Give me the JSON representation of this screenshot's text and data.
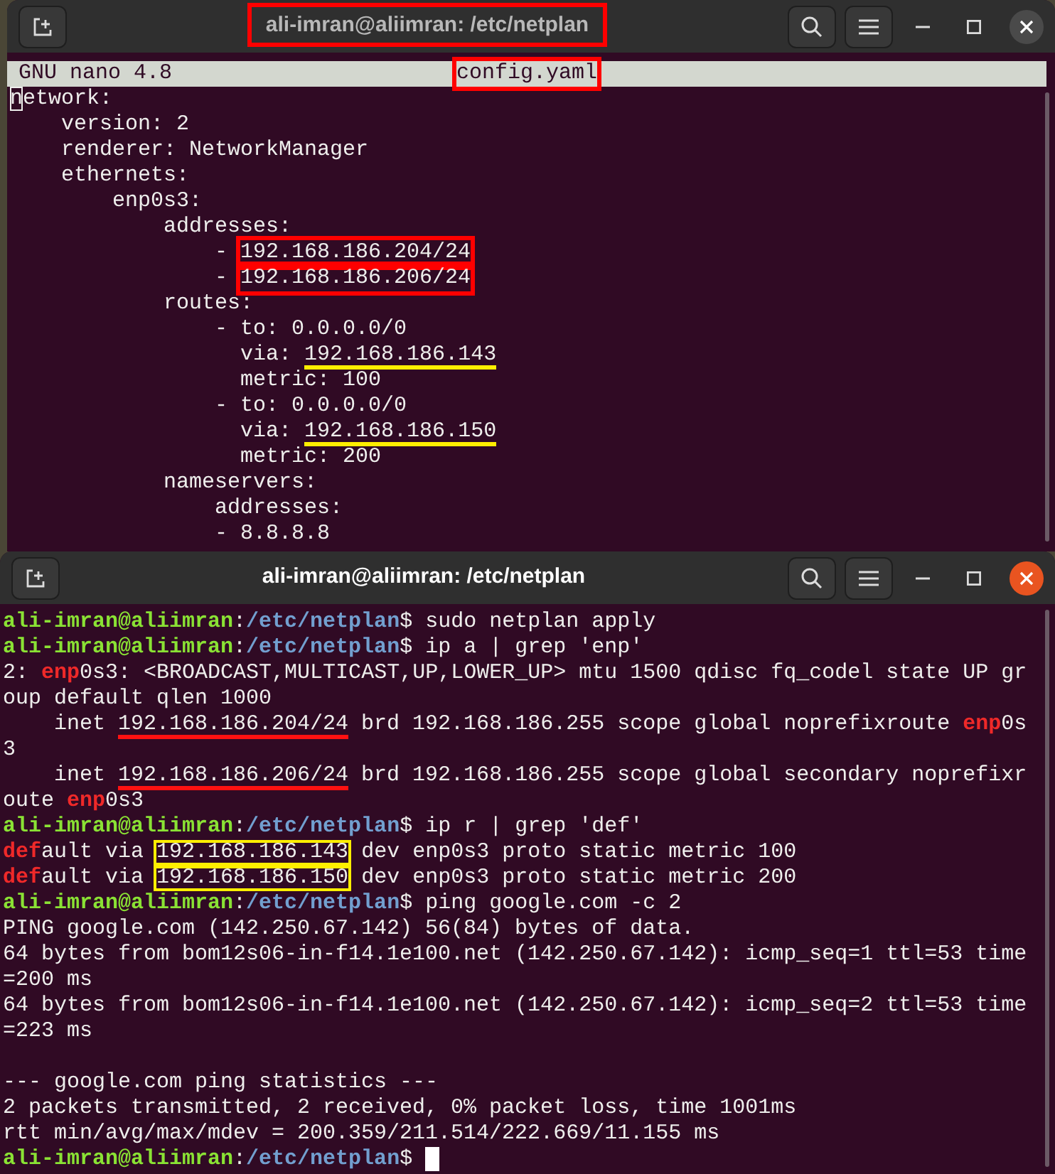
{
  "windows": [
    {
      "title": "ali-imran@aliimran: /etc/netplan",
      "active": false,
      "title_boxed": true,
      "editor": {
        "app": "GNU nano 4.8",
        "filename": "config.yaml",
        "filename_boxed": true
      },
      "lines": [
        {
          "segments": [
            {
              "text": "n",
              "kind": "cursor"
            },
            {
              "text": "etwork:"
            }
          ]
        },
        {
          "segments": [
            {
              "text": "    version: 2"
            }
          ]
        },
        {
          "segments": [
            {
              "text": "    renderer: NetworkManager"
            }
          ]
        },
        {
          "segments": [
            {
              "text": "    ethernets:"
            }
          ]
        },
        {
          "segments": [
            {
              "text": "        enp0s3:"
            }
          ]
        },
        {
          "segments": [
            {
              "text": "            addresses:"
            }
          ]
        },
        {
          "segments": [
            {
              "text": "                - "
            },
            {
              "text": "192.168.186.204/24",
              "kind": "redbox"
            }
          ]
        },
        {
          "segments": [
            {
              "text": "                - "
            },
            {
              "text": "192.168.186.206/24",
              "kind": "redbox"
            }
          ]
        },
        {
          "segments": [
            {
              "text": "            routes:"
            }
          ]
        },
        {
          "segments": [
            {
              "text": "                - to: 0.0.0.0/0"
            }
          ]
        },
        {
          "segments": [
            {
              "text": "                  via: "
            },
            {
              "text": "192.168.186.143",
              "kind": "underline"
            }
          ]
        },
        {
          "segments": [
            {
              "text": "                  metric: 100"
            }
          ]
        },
        {
          "segments": [
            {
              "text": "                - to: 0.0.0.0/0"
            }
          ]
        },
        {
          "segments": [
            {
              "text": "                  via: "
            },
            {
              "text": "192.168.186.150",
              "kind": "underline"
            }
          ]
        },
        {
          "segments": [
            {
              "text": "                  metric: 200"
            }
          ]
        },
        {
          "segments": [
            {
              "text": "            nameservers:"
            }
          ]
        },
        {
          "segments": [
            {
              "text": "                addresses:"
            }
          ]
        },
        {
          "segments": [
            {
              "text": "                - 8.8.8.8"
            }
          ]
        }
      ]
    },
    {
      "title": "ali-imran@aliimran: /etc/netplan",
      "active": true,
      "lines": [
        {
          "segments": [
            {
              "text": "ali-imran@aliimran",
              "kind": "user"
            },
            {
              "text": ":"
            },
            {
              "text": "/etc/netplan",
              "kind": "path"
            },
            {
              "text": "$ sudo netplan apply"
            }
          ]
        },
        {
          "segments": [
            {
              "text": "ali-imran@aliimran",
              "kind": "user"
            },
            {
              "text": ":"
            },
            {
              "text": "/etc/netplan",
              "kind": "path"
            },
            {
              "text": "$ ip a | grep 'enp'"
            }
          ]
        },
        {
          "segments": [
            {
              "text": "2: "
            },
            {
              "text": "enp",
              "kind": "match"
            },
            {
              "text": "0s3: <BROADCAST,MULTICAST,UP,LOWER_UP> mtu 1500 qdisc fq_codel state UP gr"
            }
          ]
        },
        {
          "segments": [
            {
              "text": "oup default qlen 1000"
            }
          ]
        },
        {
          "segments": [
            {
              "text": "    inet "
            },
            {
              "text": "192.168.186.204/24",
              "kind": "redline"
            },
            {
              "text": " brd 192.168.186.255 scope global noprefixroute "
            },
            {
              "text": "enp",
              "kind": "match"
            },
            {
              "text": "0s"
            }
          ]
        },
        {
          "segments": [
            {
              "text": "3"
            }
          ]
        },
        {
          "segments": [
            {
              "text": "    inet "
            },
            {
              "text": "192.168.186.206/24",
              "kind": "redline"
            },
            {
              "text": " brd 192.168.186.255 scope global secondary noprefixr"
            }
          ]
        },
        {
          "segments": [
            {
              "text": "oute "
            },
            {
              "text": "enp",
              "kind": "match"
            },
            {
              "text": "0s3"
            }
          ]
        },
        {
          "segments": [
            {
              "text": "ali-imran@aliimran",
              "kind": "user"
            },
            {
              "text": ":"
            },
            {
              "text": "/etc/netplan",
              "kind": "path"
            },
            {
              "text": "$ ip r | grep 'def'"
            }
          ]
        },
        {
          "segments": [
            {
              "text": "def",
              "kind": "match"
            },
            {
              "text": "ault via "
            },
            {
              "text": "192.168.186.143",
              "kind": "framed"
            },
            {
              "text": " dev enp0s3 proto static metric 100"
            }
          ]
        },
        {
          "segments": [
            {
              "text": "def",
              "kind": "match"
            },
            {
              "text": "ault via "
            },
            {
              "text": "192.168.186.150",
              "kind": "framed"
            },
            {
              "text": " dev enp0s3 proto static metric 200"
            }
          ]
        },
        {
          "segments": [
            {
              "text": "ali-imran@aliimran",
              "kind": "user"
            },
            {
              "text": ":"
            },
            {
              "text": "/etc/netplan",
              "kind": "path"
            },
            {
              "text": "$ ping google.com -c 2"
            }
          ]
        },
        {
          "segments": [
            {
              "text": "PING google.com (142.250.67.142) 56(84) bytes of data."
            }
          ]
        },
        {
          "segments": [
            {
              "text": "64 bytes from bom12s06-in-f14.1e100.net (142.250.67.142): icmp_seq=1 ttl=53 time"
            }
          ]
        },
        {
          "segments": [
            {
              "text": "=200 ms"
            }
          ]
        },
        {
          "segments": [
            {
              "text": "64 bytes from bom12s06-in-f14.1e100.net (142.250.67.142): icmp_seq=2 ttl=53 time"
            }
          ]
        },
        {
          "segments": [
            {
              "text": "=223 ms"
            }
          ]
        },
        {
          "spaced": true,
          "segments": [
            {
              "text": "--- google.com ping statistics ---"
            }
          ]
        },
        {
          "segments": [
            {
              "text": "2 packets transmitted, 2 received, 0% packet loss, time 1001ms"
            }
          ]
        },
        {
          "segments": [
            {
              "text": "rtt min/avg/max/mdev = 200.359/211.514/222.669/11.155 ms"
            }
          ]
        },
        {
          "cursor": true,
          "segments": [
            {
              "text": "ali-imran@aliimran",
              "kind": "user"
            },
            {
              "text": ":"
            },
            {
              "text": "/etc/netplan",
              "kind": "path"
            },
            {
              "text": "$ "
            }
          ]
        }
      ]
    }
  ]
}
